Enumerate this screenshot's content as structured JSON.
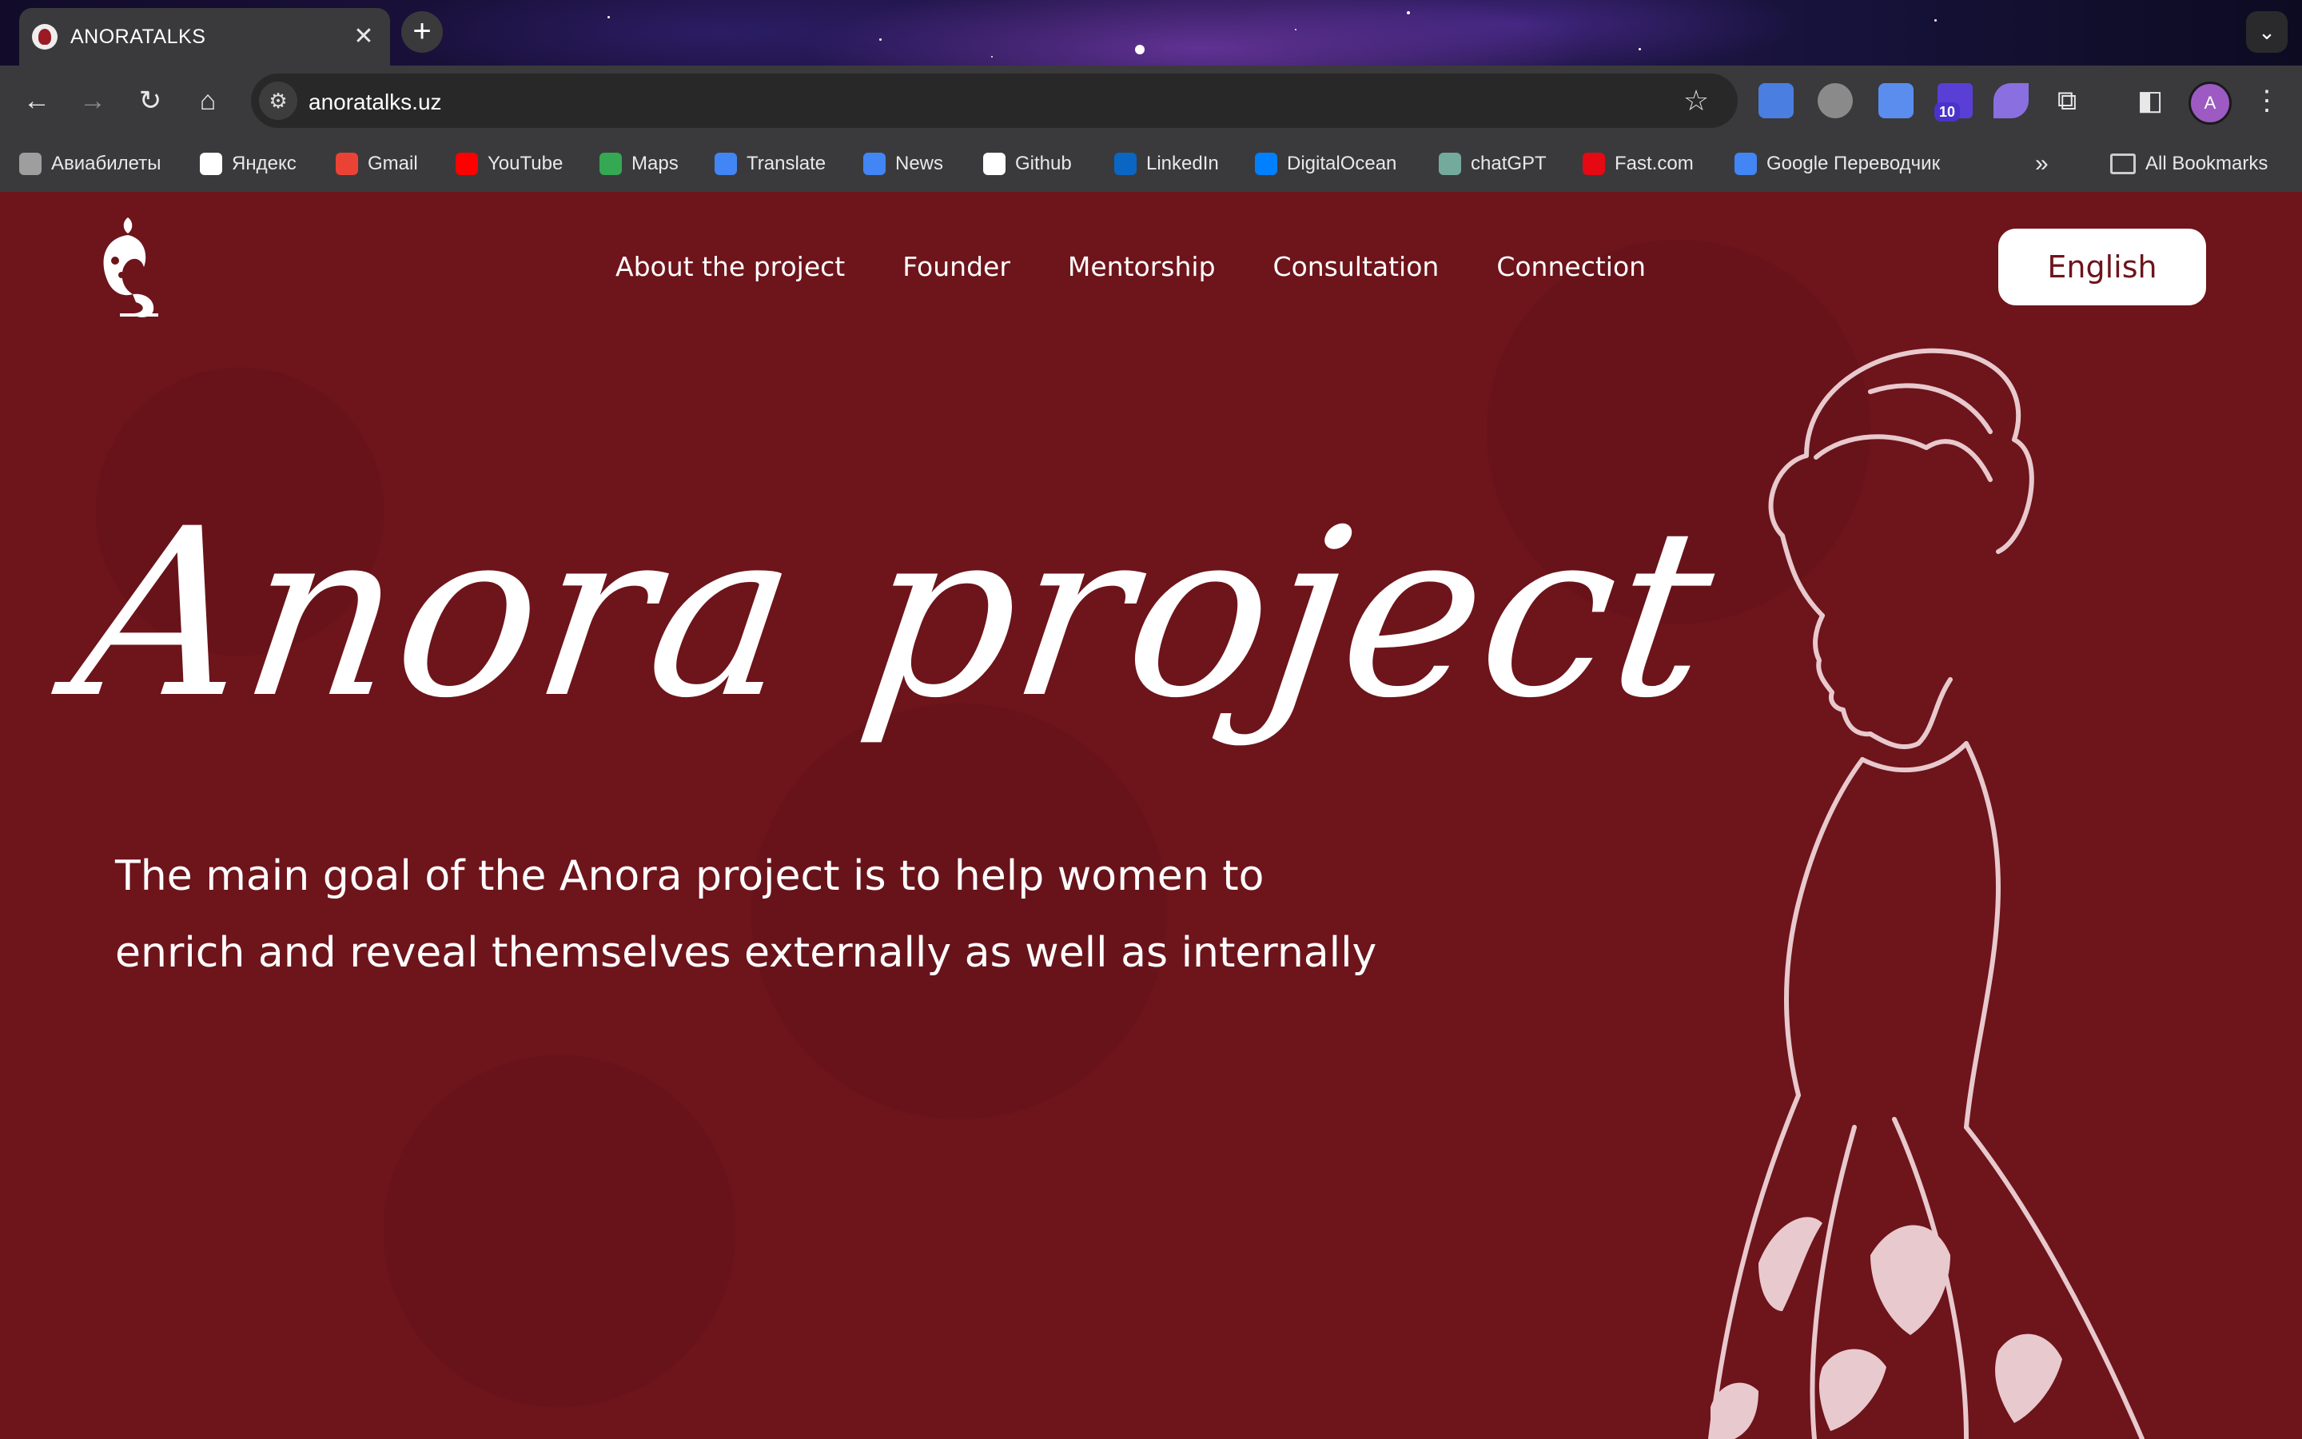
{
  "browser": {
    "tab_title": "ANORATALKS",
    "url": "anoratalks.uz",
    "extension_badge": "10",
    "profile_initial": "A",
    "bookmarks": [
      {
        "label": "Авиабилеты",
        "icon": "globe-icon",
        "color": "#9e9e9e"
      },
      {
        "label": "Яндекс",
        "icon": "sparkle-icon",
        "color": "#ffffff"
      },
      {
        "label": "Gmail",
        "icon": "gmail-icon",
        "color": "#ea4335"
      },
      {
        "label": "YouTube",
        "icon": "youtube-icon",
        "color": "#ff0000"
      },
      {
        "label": "Maps",
        "icon": "maps-pin-icon",
        "color": "#34a853"
      },
      {
        "label": "Translate",
        "icon": "translate-icon",
        "color": "#4285f4"
      },
      {
        "label": "News",
        "icon": "news-icon",
        "color": "#4285f4"
      },
      {
        "label": "Github",
        "icon": "github-icon",
        "color": "#ffffff"
      },
      {
        "label": "LinkedIn",
        "icon": "linkedin-icon",
        "color": "#0a66c2"
      },
      {
        "label": "DigitalOcean",
        "icon": "digitalocean-icon",
        "color": "#0080ff"
      },
      {
        "label": "chatGPT",
        "icon": "chatgpt-icon",
        "color": "#74aa9c"
      },
      {
        "label": "Fast.com",
        "icon": "speedometer-icon",
        "color": "#e50914"
      },
      {
        "label": "Google Переводчик",
        "icon": "translate-icon",
        "color": "#4285f4"
      }
    ],
    "all_bookmarks_label": "All Bookmarks"
  },
  "site": {
    "nav": [
      "About the project",
      "Founder",
      "Mentorship",
      "Consultation",
      "Connection"
    ],
    "language_button": "English",
    "hero_title": "Anora project",
    "hero_text": "The main goal of the Anora project is to help women to enrich and reveal themselves externally as well as internally"
  },
  "colors": {
    "brand_background": "#6e141b",
    "accent_light": "#e8c9cd",
    "white": "#ffffff"
  }
}
